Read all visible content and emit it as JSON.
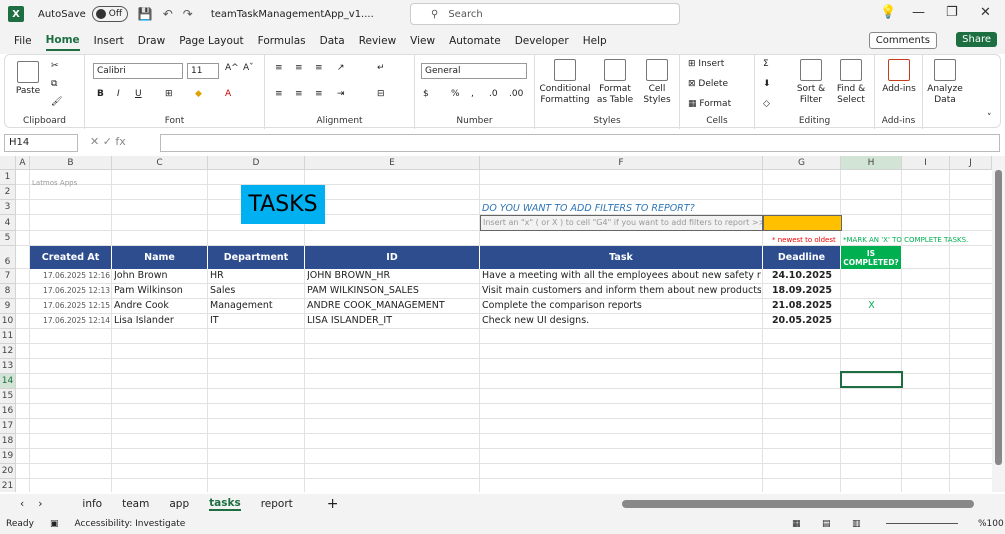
{
  "titlebar": {
    "autosave": "AutoSave",
    "toggle": "Off",
    "filename": "teamTaskManagementApp_v1....",
    "search": "Search"
  },
  "menu": [
    "File",
    "Home",
    "Insert",
    "Draw",
    "Page Layout",
    "Formulas",
    "Data",
    "Review",
    "View",
    "Automate",
    "Developer",
    "Help"
  ],
  "comments": "Comments",
  "share": "Share",
  "ribbon": {
    "clipboard": {
      "paste": "Paste",
      "label": "Clipboard"
    },
    "font": {
      "name": "Calibri",
      "size": "11",
      "label": "Font"
    },
    "alignment": {
      "label": "Alignment"
    },
    "number": {
      "format": "General",
      "label": "Number"
    },
    "styles": {
      "cf": "Conditional Formatting",
      "fat": "Format as Table",
      "cs": "Cell Styles",
      "label": "Styles"
    },
    "cells": {
      "insert": "Insert",
      "delete": "Delete",
      "format": "Format",
      "label": "Cells"
    },
    "editing": {
      "sort": "Sort & Filter",
      "find": "Find & Select",
      "label": "Editing"
    },
    "addins": {
      "addins": "Add-ins",
      "label": "Add-ins"
    },
    "analyze": {
      "label": "Analyze Data"
    }
  },
  "namebox": "H14",
  "columns": [
    "A",
    "B",
    "C",
    "D",
    "E",
    "F",
    "G",
    "H",
    "I",
    "J"
  ],
  "rows": [
    "1",
    "2",
    "3",
    "4",
    "5",
    "6",
    "7",
    "8",
    "9",
    "10",
    "11",
    "12",
    "13",
    "14",
    "15",
    "16",
    "17",
    "18",
    "19",
    "20",
    "21"
  ],
  "sheet": {
    "brand": "Latmos Apps",
    "title": "TASKS",
    "filter_question": "DO YOU WANT TO ADD FILTERS TO REPORT?",
    "filter_hint": "Insert an \"x\"  ( or X ) to cell \"G4\" if you want to add filters to report >>",
    "newest_note": "* newest to oldest",
    "mark_note": "*MARK AN 'X' TO COMPLETE TASKS.",
    "headers": [
      "Created At",
      "Name",
      "Department",
      "ID",
      "Task",
      "Deadline",
      "IS COMPLETED?"
    ],
    "data": [
      [
        "17.06.2025 12:16",
        "John Brown",
        "HR",
        "JOHN BROWN_HR",
        "Have a meeting with all the employees about new safety rules",
        "24.10.2025",
        ""
      ],
      [
        "17.06.2025 12:13",
        "Pam Wilkinson",
        "Sales",
        "PAM WILKINSON_SALES",
        "Visit main customers and inform them about new products.",
        "18.09.2025",
        ""
      ],
      [
        "17.06.2025 12:15",
        "Andre Cook",
        "Management",
        "ANDRE COOK_MANAGEMENT",
        "Complete the comparison reports",
        "21.08.2025",
        "X"
      ],
      [
        "17.06.2025 12:14",
        "Lisa Islander",
        "IT",
        "LISA ISLANDER_IT",
        "Check new UI designs.",
        "20.05.2025",
        ""
      ]
    ]
  },
  "tabs": [
    "info",
    "team",
    "app",
    "tasks",
    "report"
  ],
  "status": {
    "ready": "Ready",
    "accessibility": "Accessibility: Investigate",
    "zoom": "%100"
  },
  "colors": {
    "header_blue": "#2e4d8f",
    "title_cyan": "#00b0f0",
    "completed_green": "#00b050",
    "filter_orange": "#ffc000",
    "excel_green": "#1d6f42"
  }
}
